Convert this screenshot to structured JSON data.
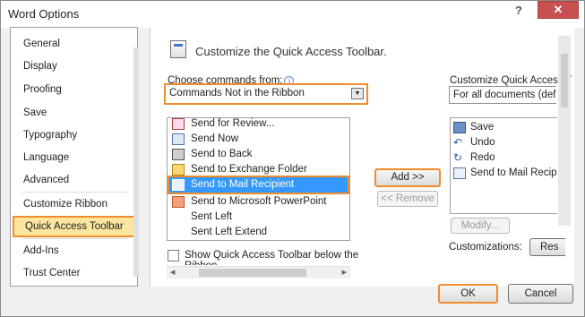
{
  "window": {
    "title": "Word Options",
    "help": "?",
    "close": "✕"
  },
  "nav": {
    "items": [
      {
        "label": "General"
      },
      {
        "label": "Display"
      },
      {
        "label": "Proofing"
      },
      {
        "label": "Save"
      },
      {
        "label": "Typography"
      },
      {
        "label": "Language"
      },
      {
        "label": "Advanced"
      },
      {
        "label": "Customize Ribbon"
      },
      {
        "label": "Quick Access Toolbar"
      },
      {
        "label": "Add-Ins"
      },
      {
        "label": "Trust Center"
      }
    ],
    "selected": "Quick Access Toolbar"
  },
  "main": {
    "heading": "Customize the Quick Access Toolbar.",
    "choose_label": "Choose commands from:",
    "choose_value": "Commands Not in the Ribbon",
    "customize_label": "Customize Quick Access T",
    "customize_value": "For all documents (defa",
    "commands": [
      {
        "label": "Send for Review...",
        "icon": "review-icon"
      },
      {
        "label": "Send Now",
        "icon": "send-now-icon"
      },
      {
        "label": "Send to Back",
        "icon": "send-back-icon"
      },
      {
        "label": "Send to Exchange Folder",
        "icon": "exchange-folder-icon"
      },
      {
        "label": "Send to Mail Recipient",
        "icon": "mail-recipient-icon",
        "selected": true
      },
      {
        "label": "Send to Microsoft PowerPoint",
        "icon": "powerpoint-icon"
      },
      {
        "label": "Sent Left",
        "icon": ""
      },
      {
        "label": "Sent Left Extend",
        "icon": ""
      }
    ],
    "toolbar_items": [
      {
        "label": "Save",
        "icon": "save-icon"
      },
      {
        "label": "Undo",
        "icon": "undo-icon"
      },
      {
        "label": "Redo",
        "icon": "redo-icon"
      },
      {
        "label": "Send to Mail Recipi",
        "icon": "mail-recipient-icon"
      }
    ],
    "add_button": "Add >>",
    "remove_button": "<< Remove",
    "modify_button": "Modify...",
    "customizations_label": "Customizations:",
    "reset_button": "Res",
    "show_below_label": "Show Quick Access Toolbar below the Ribbon"
  },
  "footer": {
    "ok": "OK",
    "cancel": "Cancel"
  },
  "colors": {
    "highlight": "#f08c2c",
    "selection": "#3399ff",
    "nav_selected": "#fbe59f"
  }
}
